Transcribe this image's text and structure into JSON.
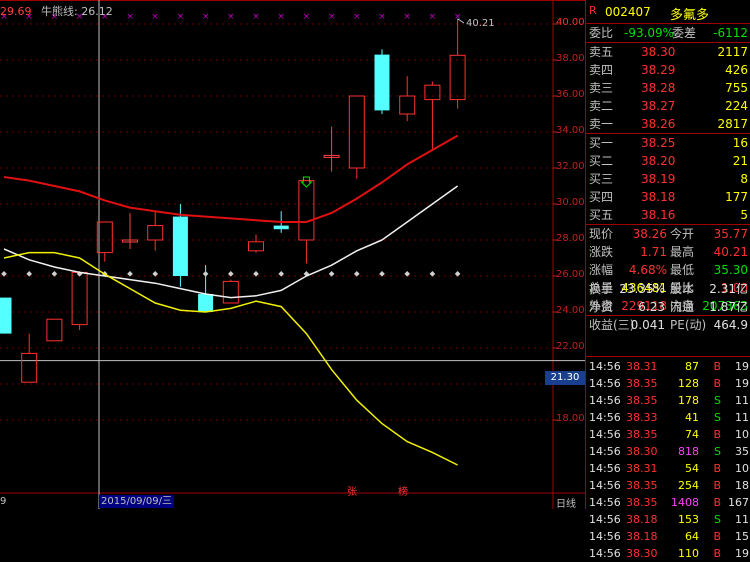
{
  "header": {
    "ma_value_1": "29.69",
    "indicator_label": "牛熊线:",
    "indicator_value": "26.12"
  },
  "chart": {
    "price_ticks": [
      "40.00",
      "38.00",
      "36.00",
      "34.00",
      "32.00",
      "30.00",
      "28.00",
      "26.00",
      "24.00",
      "22.00",
      "20.00",
      "18.00"
    ],
    "high_label": "40.21",
    "cursor_price": "21.30",
    "cursor_date": "2015/09/09/三",
    "left_edge_label": "9",
    "timeframe": "日线",
    "markers": [
      "张",
      "榜"
    ]
  },
  "quote": {
    "r_mark": "R",
    "code": "002407",
    "name": "多氟多",
    "wei_bi_label": "委比",
    "wei_bi": "-93.09%",
    "wei_cha_label": "委差",
    "wei_cha": "-6112",
    "asks": [
      {
        "label": "卖五",
        "price": "38.30",
        "vol": "2117"
      },
      {
        "label": "卖四",
        "price": "38.29",
        "vol": "426"
      },
      {
        "label": "卖三",
        "price": "38.28",
        "vol": "755"
      },
      {
        "label": "卖二",
        "price": "38.27",
        "vol": "224"
      },
      {
        "label": "卖一",
        "price": "38.26",
        "vol": "2817"
      }
    ],
    "bids": [
      {
        "label": "买一",
        "price": "38.25",
        "vol": "16"
      },
      {
        "label": "买二",
        "price": "38.20",
        "vol": "21"
      },
      {
        "label": "买三",
        "price": "38.19",
        "vol": "8"
      },
      {
        "label": "买四",
        "price": "38.18",
        "vol": "177"
      },
      {
        "label": "买五",
        "price": "38.16",
        "vol": "5"
      }
    ],
    "stats": [
      {
        "l1": "现价",
        "v1": "38.26",
        "l2": "今开",
        "v2": "35.77"
      },
      {
        "l1": "涨跌",
        "v1": "1.71",
        "l2": "最高",
        "v2": "40.21"
      },
      {
        "l1": "涨幅",
        "v1": "4.68%",
        "l2": "最低",
        "v2": "35.30"
      },
      {
        "l1": "总量",
        "v1": "436481",
        "l2": "量比",
        "v2": "1.00"
      },
      {
        "l1": "外盘",
        "v1": "229118",
        "l2": "内盘",
        "v2": "207363"
      }
    ],
    "stats2": [
      {
        "l1": "换手",
        "v1": "23.35%",
        "l2": "股本",
        "v2": "2.31亿"
      },
      {
        "l1": "净资",
        "v1": "6.23",
        "l2": "流通",
        "v2": "1.87亿"
      },
      {
        "l1": "收益(三)",
        "v1": "0.041",
        "l2": "PE(动)",
        "v2": "464.9"
      }
    ],
    "ticks": [
      {
        "t": "14:56",
        "p": "38.31",
        "v": "87",
        "d": "B",
        "n": "19"
      },
      {
        "t": "14:56",
        "p": "38.35",
        "v": "128",
        "d": "B",
        "n": "19"
      },
      {
        "t": "14:56",
        "p": "38.35",
        "v": "178",
        "d": "S",
        "n": "11"
      },
      {
        "t": "14:56",
        "p": "38.33",
        "v": "41",
        "d": "S",
        "n": "11"
      },
      {
        "t": "14:56",
        "p": "38.35",
        "v": "74",
        "d": "B",
        "n": "10"
      },
      {
        "t": "14:56",
        "p": "38.30",
        "v": "818",
        "d": "S",
        "n": "35"
      },
      {
        "t": "14:56",
        "p": "38.31",
        "v": "54",
        "d": "B",
        "n": "10"
      },
      {
        "t": "14:56",
        "p": "38.35",
        "v": "254",
        "d": "B",
        "n": "18"
      },
      {
        "t": "14:56",
        "p": "38.35",
        "v": "1408",
        "d": "B",
        "n": "167"
      },
      {
        "t": "14:56",
        "p": "38.18",
        "v": "153",
        "d": "S",
        "n": "11"
      },
      {
        "t": "14:56",
        "p": "38.18",
        "v": "64",
        "d": "B",
        "n": "15"
      },
      {
        "t": "14:56",
        "p": "38.30",
        "v": "110",
        "d": "B",
        "n": "19"
      }
    ]
  },
  "chart_data": {
    "type": "candlestick",
    "candles": [
      {
        "o": 24.8,
        "h": 24.8,
        "l": 22.8,
        "c": 22.8,
        "dir": "down"
      },
      {
        "o": 20.1,
        "h": 22.8,
        "l": 20.1,
        "c": 21.7,
        "dir": "up"
      },
      {
        "o": 22.4,
        "h": 23.6,
        "l": 22.4,
        "c": 23.6,
        "dir": "up"
      },
      {
        "o": 23.3,
        "h": 26.2,
        "l": 23.0,
        "c": 26.2,
        "dir": "up"
      },
      {
        "o": 27.3,
        "h": 29.0,
        "l": 26.8,
        "c": 29.0,
        "dir": "up"
      },
      {
        "o": 28.0,
        "h": 29.5,
        "l": 27.5,
        "c": 28.0,
        "dir": "doji"
      },
      {
        "o": 28.0,
        "h": 29.6,
        "l": 27.4,
        "c": 28.8,
        "dir": "up"
      },
      {
        "o": 29.3,
        "h": 30.0,
        "l": 25.4,
        "c": 26.0,
        "dir": "down"
      },
      {
        "o": 25.0,
        "h": 26.6,
        "l": 24.0,
        "c": 24.0,
        "dir": "down"
      },
      {
        "o": 24.5,
        "h": 25.8,
        "l": 24.5,
        "c": 25.7,
        "dir": "up"
      },
      {
        "o": 27.4,
        "h": 28.3,
        "l": 27.3,
        "c": 27.9,
        "dir": "up"
      },
      {
        "o": 28.8,
        "h": 29.6,
        "l": 28.4,
        "c": 28.6,
        "dir": "down"
      },
      {
        "o": 28.0,
        "h": 31.3,
        "l": 26.7,
        "c": 31.3,
        "dir": "up"
      },
      {
        "o": 32.7,
        "h": 34.3,
        "l": 31.8,
        "c": 32.7,
        "dir": "doji"
      },
      {
        "o": 32.0,
        "h": 36.0,
        "l": 31.4,
        "c": 36.0,
        "dir": "up"
      },
      {
        "o": 38.3,
        "h": 38.6,
        "l": 35.0,
        "c": 35.2,
        "dir": "down"
      },
      {
        "o": 35.0,
        "h": 37.1,
        "l": 34.6,
        "c": 36.0,
        "dir": "up"
      },
      {
        "o": 35.8,
        "h": 36.8,
        "l": 33.0,
        "c": 36.6,
        "dir": "up"
      },
      {
        "o": 35.8,
        "h": 40.21,
        "l": 35.3,
        "c": 38.26,
        "dir": "up"
      }
    ],
    "ma_red": [
      31.5,
      31.3,
      31.0,
      30.7,
      30.2,
      29.8,
      29.6,
      29.4,
      29.3,
      29.2,
      29.1,
      29.0,
      29.0,
      29.5,
      30.3,
      31.2,
      32.2,
      33.0,
      33.8
    ],
    "ma_white": [
      27.5,
      26.9,
      26.5,
      26.2,
      26.0,
      25.8,
      25.6,
      25.3,
      25.0,
      24.8,
      24.9,
      25.2,
      26.0,
      26.6,
      27.4,
      28.0,
      29.0,
      30.0,
      31.0
    ],
    "ma_yellow": [
      27.0,
      27.3,
      27.3,
      27.0,
      26.1,
      25.3,
      24.5,
      24.1,
      24.0,
      24.2,
      24.6,
      24.3,
      22.8,
      20.8,
      19.1,
      17.8,
      16.8,
      16.2,
      15.5
    ],
    "bull_bear_line": 26.12,
    "y_axis": {
      "min": 16.0,
      "max": 40.0,
      "ticks": [
        18,
        20,
        22,
        24,
        26,
        28,
        30,
        32,
        34,
        36,
        38,
        40
      ]
    }
  }
}
